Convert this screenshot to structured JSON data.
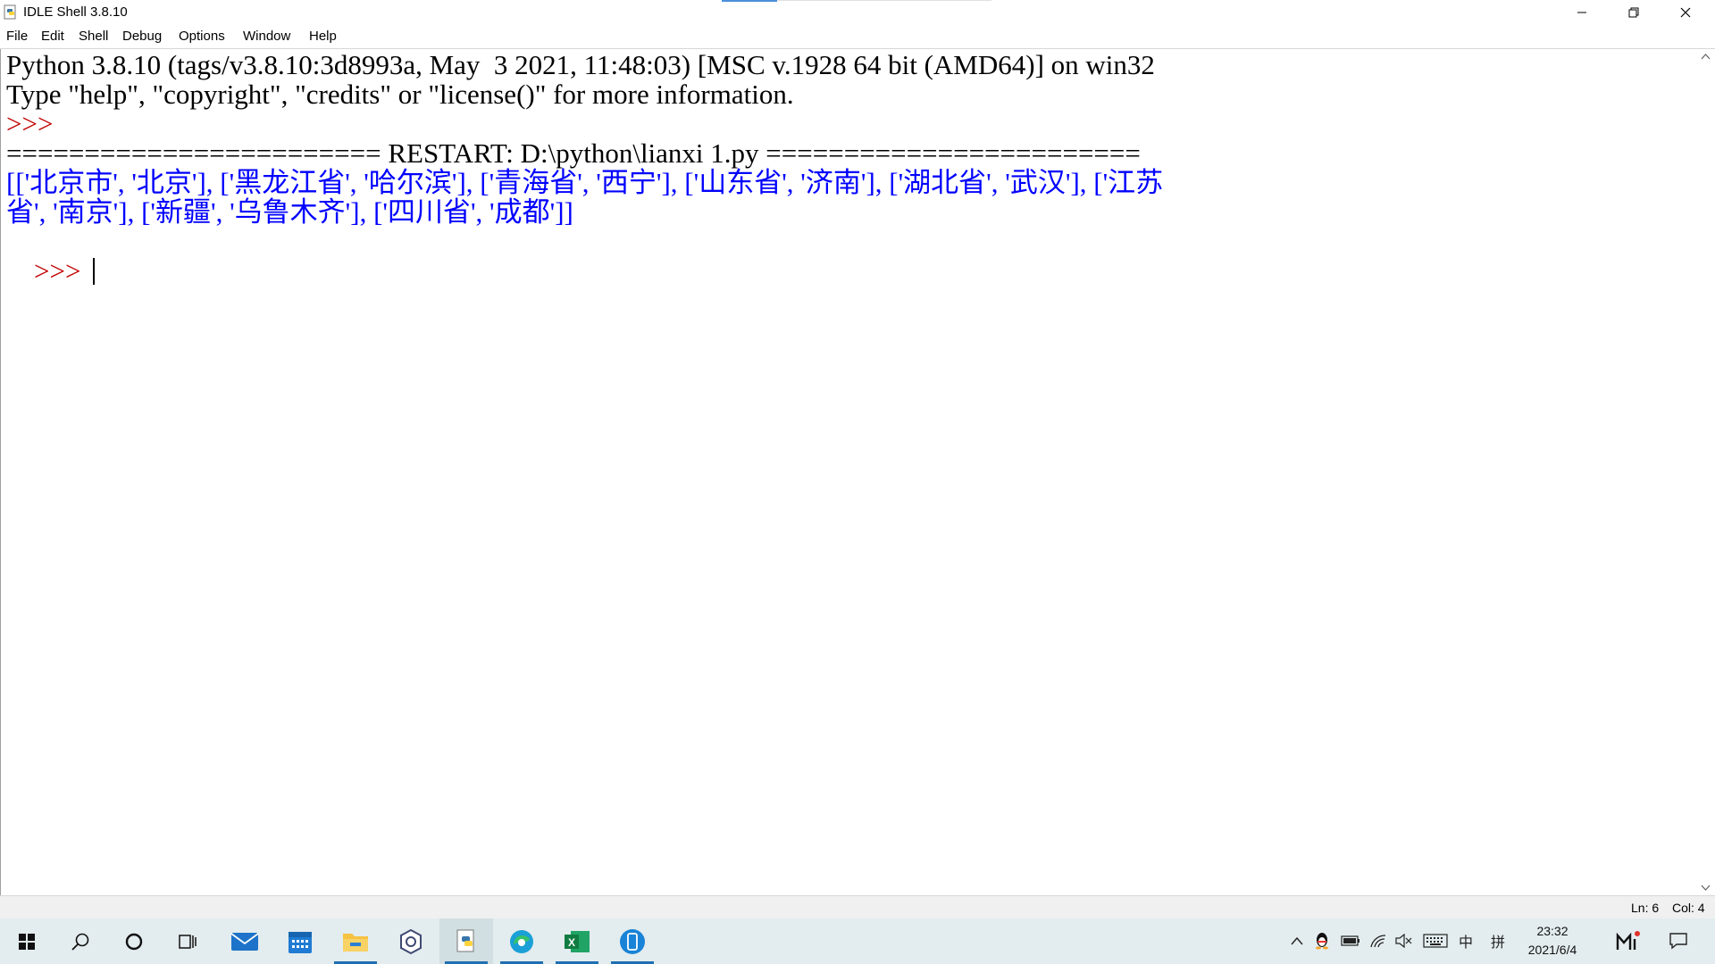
{
  "window": {
    "title": "IDLE Shell 3.8.10"
  },
  "menu": {
    "items": [
      "File",
      "Edit",
      "Shell",
      "Debug",
      "Options",
      "Window",
      "Help"
    ]
  },
  "shell": {
    "banner_line1": "Python 3.8.10 (tags/v3.8.10:3d8993a, May  3 2021, 11:48:03) [MSC v.1928 64 bit (AMD64)] on win32",
    "banner_line2": "Type \"help\", \"copyright\", \"credits\" or \"license()\" for more information.",
    "prompt": ">>>",
    "restart_line": "======================== RESTART: D:\\python\\lianxi 1.py ========================",
    "output_line1": "[['北京市', '北京'], ['黑龙江省', '哈尔滨'], ['青海省', '西宁'], ['山东省', '济南'], ['湖北省', '武汉'], ['江苏",
    "output_line2": "省', '南京'], ['新疆', '乌鲁木齐'], ['四川省', '成都']]"
  },
  "statusbar": {
    "line": "Ln: 6",
    "col": "Col: 4"
  },
  "taskbar": {
    "apps": [
      "start-icon",
      "search-icon",
      "cortana-icon",
      "task-view-icon",
      "mail-icon",
      "calendar-icon",
      "file-explorer-icon",
      "settings-app-icon",
      "python-idle-icon",
      "edge-icon",
      "excel-icon",
      "phone-app-icon"
    ],
    "tray": {
      "ime_lang": "中",
      "ime_mode": "拼",
      "time": "23:32",
      "date": "2021/6/4"
    }
  },
  "colors": {
    "prompt": "#c00000",
    "stdout": "#0000ff",
    "taskbar_bg": "#e3ecee",
    "accent": "#1f6fb2"
  }
}
